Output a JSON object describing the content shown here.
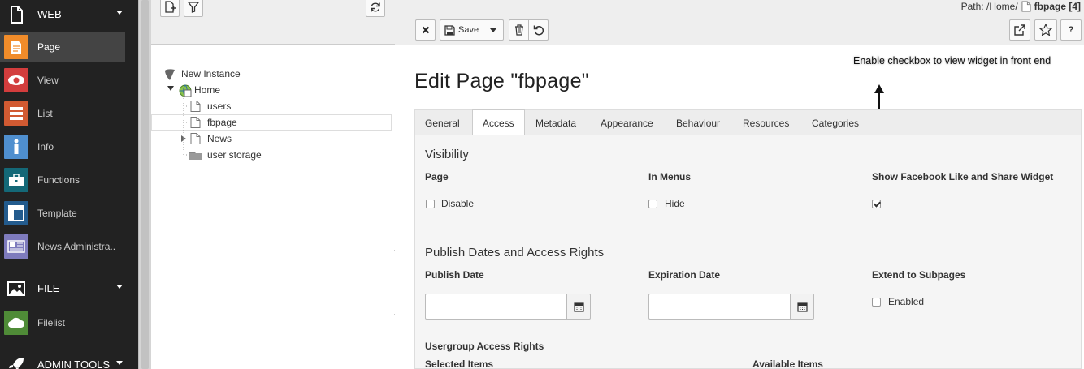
{
  "module_menu": {
    "groups": [
      {
        "label": "WEB",
        "icon": "document-icon"
      },
      {
        "label": "FILE",
        "icon": "image-icon"
      },
      {
        "label": "ADMIN TOOLS",
        "icon": "rocket-icon"
      }
    ],
    "items": [
      {
        "label": "Page",
        "icon": "page-icon",
        "color": "#f18c2a",
        "active": true
      },
      {
        "label": "View",
        "icon": "eye-icon",
        "color": "#d33d3d"
      },
      {
        "label": "List",
        "icon": "list-icon",
        "color": "#d15a32"
      },
      {
        "label": "Info",
        "icon": "info-icon",
        "color": "#4f8fcf"
      },
      {
        "label": "Functions",
        "icon": "briefcase-icon",
        "color": "#146877"
      },
      {
        "label": "Template",
        "icon": "template-icon",
        "color": "#235b8d"
      },
      {
        "label": "News Administra..",
        "icon": "news-icon",
        "color": "#7e7bbd"
      },
      {
        "label": "Filelist",
        "icon": "cloud-icon",
        "color": "#4f8b37"
      }
    ]
  },
  "page_tree": {
    "nodes": [
      {
        "label": "New Instance",
        "icon": "typo3-icon"
      },
      {
        "label": "Home",
        "icon": "globe-page-icon"
      },
      {
        "label": "users",
        "icon": "page-icon"
      },
      {
        "label": "fbpage",
        "icon": "page-icon"
      },
      {
        "label": "News",
        "icon": "page-icon"
      },
      {
        "label": "user storage",
        "icon": "folder-icon"
      }
    ]
  },
  "doc_header": {
    "path_prefix": "Path: /Home/",
    "path_current": "fbpage [4]",
    "save_label": "Save"
  },
  "title": "Edit Page \"fbpage\"",
  "annotation": "Enable checkbox to view widget in front end",
  "tabs": [
    "General",
    "Access",
    "Metadata",
    "Appearance",
    "Behaviour",
    "Resources",
    "Categories"
  ],
  "active_tab": "Access",
  "visibility": {
    "title": "Visibility",
    "page_label": "Page",
    "disable_label": "Disable",
    "disable_checked": false,
    "in_menus_label": "In Menus",
    "hide_label": "Hide",
    "hide_checked": false,
    "fb_label": "Show Facebook Like and Share Widget",
    "fb_checked": true
  },
  "publish": {
    "title": "Publish Dates and Access Rights",
    "publish_date_label": "Publish Date",
    "publish_date_value": "",
    "expiration_date_label": "Expiration Date",
    "expiration_date_value": "",
    "extend_label": "Extend to Subpages",
    "enabled_label": "Enabled",
    "enabled_checked": false,
    "usergroup_label": "Usergroup Access Rights",
    "selected_items_label": "Selected Items",
    "available_items_label": "Available Items"
  }
}
